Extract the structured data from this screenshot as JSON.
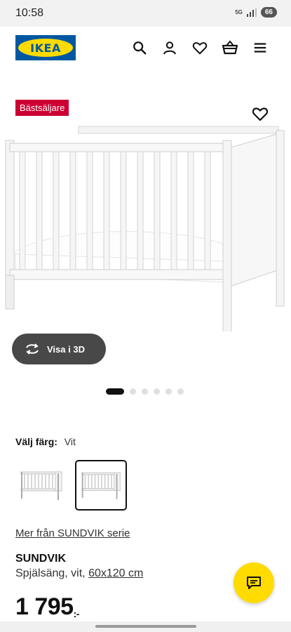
{
  "status_bar": {
    "time": "10:58",
    "network": "5G",
    "battery": "66"
  },
  "header": {
    "logo": "IKEA"
  },
  "icons": {
    "search": "search-icon",
    "account": "user-icon",
    "wishlist": "heart-icon",
    "cart": "basket-icon",
    "menu": "hamburger-menu-icon",
    "view3d": "rotate-3d-icon",
    "chat": "chat-icon"
  },
  "product": {
    "badge": "Bästsäljare",
    "view_3d_label": "Visa i 3D",
    "carousel": {
      "count": 6,
      "active": 1
    },
    "color_label": "Välj färg:",
    "color_value": "Vit",
    "series_link": "Mer från SUNDVIK serie",
    "name": "SUNDVIK",
    "description": "Spjälsäng, vit,",
    "size": "60x120 cm",
    "price": "1 795",
    "price_suffix": ":-"
  },
  "colors": {
    "brand_blue": "#0058a3",
    "brand_yellow": "#ffdb00",
    "badge_red": "#cc0033"
  }
}
